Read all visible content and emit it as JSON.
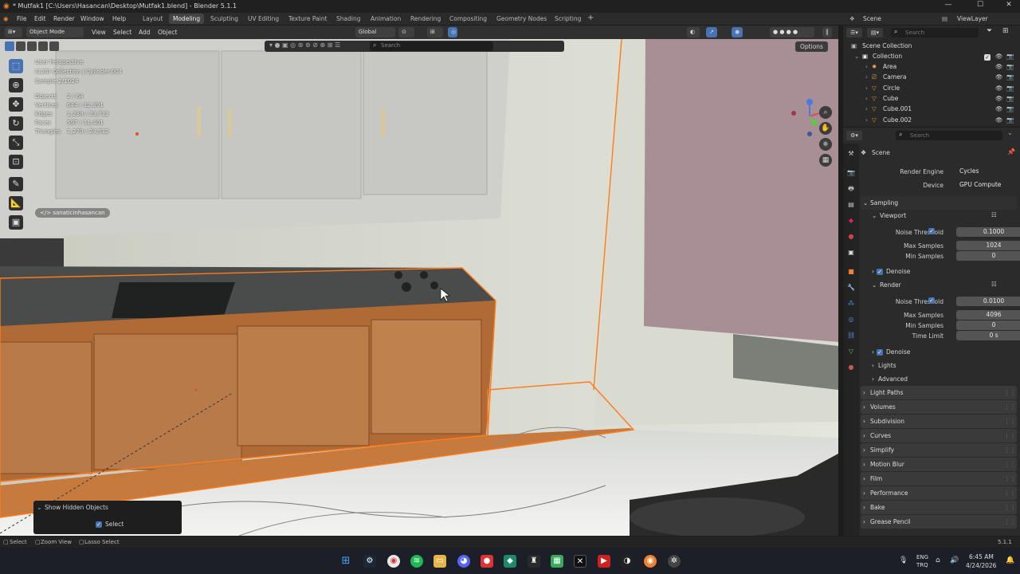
{
  "titlebar": {
    "title": "* Mutfak1 [C:\\Users\\Hasancan\\Desktop\\Mutfak1.blend] - Blender 5.1.1",
    "minimize": "—",
    "maximize": "☐",
    "close": "✕"
  },
  "menu": {
    "file": "File",
    "edit": "Edit",
    "render": "Render",
    "window": "Window",
    "help": "Help"
  },
  "workspaces": [
    "Layout",
    "Modeling",
    "Sculpting",
    "UV Editing",
    "Texture Paint",
    "Shading",
    "Animation",
    "Rendering",
    "Compositing",
    "Geometry Nodes",
    "Scripting"
  ],
  "active_workspace_index": 1,
  "add_tab": "+",
  "scene": {
    "label": "Scene",
    "view_layer": "ViewLayer"
  },
  "viewport_header": {
    "mode": "Object Mode",
    "view": "View",
    "select": "Select",
    "add": "Add",
    "object": "Object",
    "transform": "Global",
    "options": "Options",
    "search_placeholder": "Search"
  },
  "viewport_info": {
    "perspective": "User Perspective",
    "collection": "(126) Collection | Cylinder.004",
    "sample": "Sample 2/1024",
    "stats": [
      {
        "label": "Objects",
        "value": "2 / 64"
      },
      {
        "label": "Vertices",
        "value": "644 / 12,391"
      },
      {
        "label": "Edges",
        "value": "1,238 / 23,712"
      },
      {
        "label": "Faces",
        "value": "597 / 11,401"
      },
      {
        "label": "Triangles",
        "value": "1,270 / 24,512"
      }
    ],
    "screencast_tag": "</> sanaticinhasancan"
  },
  "hidden_panel": {
    "header": "Show Hidden Objects",
    "option": "Select"
  },
  "outliner": {
    "title": "Scene Collection",
    "search_placeholder": "Search",
    "collection": "Collection",
    "items": [
      {
        "name": "Area",
        "icon": "light-icon",
        "color": "#e0a050"
      },
      {
        "name": "Camera",
        "icon": "camera-icon",
        "color": "#e0a050"
      },
      {
        "name": "Circle",
        "icon": "mesh-icon",
        "color": "#e08a2c"
      },
      {
        "name": "Cube",
        "icon": "mesh-icon",
        "color": "#e08a2c"
      },
      {
        "name": "Cube.001",
        "icon": "mesh-icon",
        "color": "#e08a2c"
      },
      {
        "name": "Cube.002",
        "icon": "mesh-icon",
        "color": "#e08a2c"
      }
    ]
  },
  "properties": {
    "search_placeholder": "Search",
    "context": "Scene",
    "render_engine_label": "Render Engine",
    "render_engine": "Cycles",
    "device_label": "Device",
    "device": "GPU Compute",
    "sampling": "Sampling",
    "viewport": "Viewport",
    "noise_threshold_label": "Noise Threshold",
    "vp_noise_threshold": "0.1000",
    "max_samples_label": "Max Samples",
    "vp_max_samples": "1024",
    "min_samples_label": "Min Samples",
    "vp_min_samples": "0",
    "denoise": "Denoise",
    "render": "Render",
    "r_noise_threshold": "0.0100",
    "r_max_samples": "4096",
    "r_min_samples": "0",
    "time_limit_label": "Time Limit",
    "r_time_limit": "0 s",
    "lights": "Lights",
    "advanced": "Advanced",
    "sections": [
      "Light Paths",
      "Volumes",
      "Subdivision",
      "Curves",
      "Simplify",
      "Motion Blur",
      "Film",
      "Performance",
      "Bake",
      "Grease Pencil"
    ]
  },
  "statusbar": {
    "select": "Select",
    "zoom": "Zoom View",
    "lasso": "Lasso Select",
    "version": "5.1.1"
  },
  "taskbar": {
    "lang": "ENG",
    "layout": "TRQ",
    "time": "6:45 AM",
    "date": "4/24/2026"
  },
  "colors": {
    "accent": "#4772b3",
    "selection": "#ff7a1a",
    "active_object": "#e87d0d"
  }
}
